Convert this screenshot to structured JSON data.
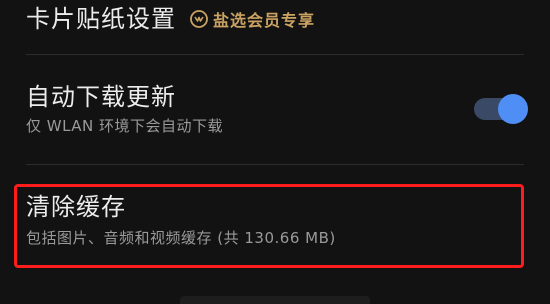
{
  "card_sticker": {
    "title": "卡片贴纸设置",
    "badge_label": "盐选会员专享",
    "badge_icon": "vip-salt-icon",
    "badge_color": "#caa262"
  },
  "auto_download": {
    "title": "自动下载更新",
    "subtitle": "仅 WLAN 环境下会自动下载",
    "toggle_state": "on",
    "toggle_color": "#4f8ef5"
  },
  "clear_cache": {
    "title": "清除缓存",
    "subtitle": "包括图片、音频和视频缓存 (共 130.66 MB)",
    "highlight_color": "#ff1c1c"
  }
}
